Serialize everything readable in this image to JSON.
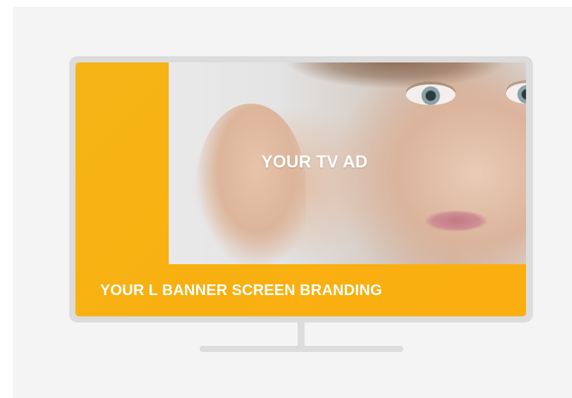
{
  "ad": {
    "label": "YOUR TV AD"
  },
  "banner": {
    "label": "YOUR L BANNER SCREEN BRANDING"
  },
  "colors": {
    "banner": "#f8b010",
    "frame": "#dcdcdc",
    "panel": "#f4f4f4",
    "text": "#ffffff"
  }
}
